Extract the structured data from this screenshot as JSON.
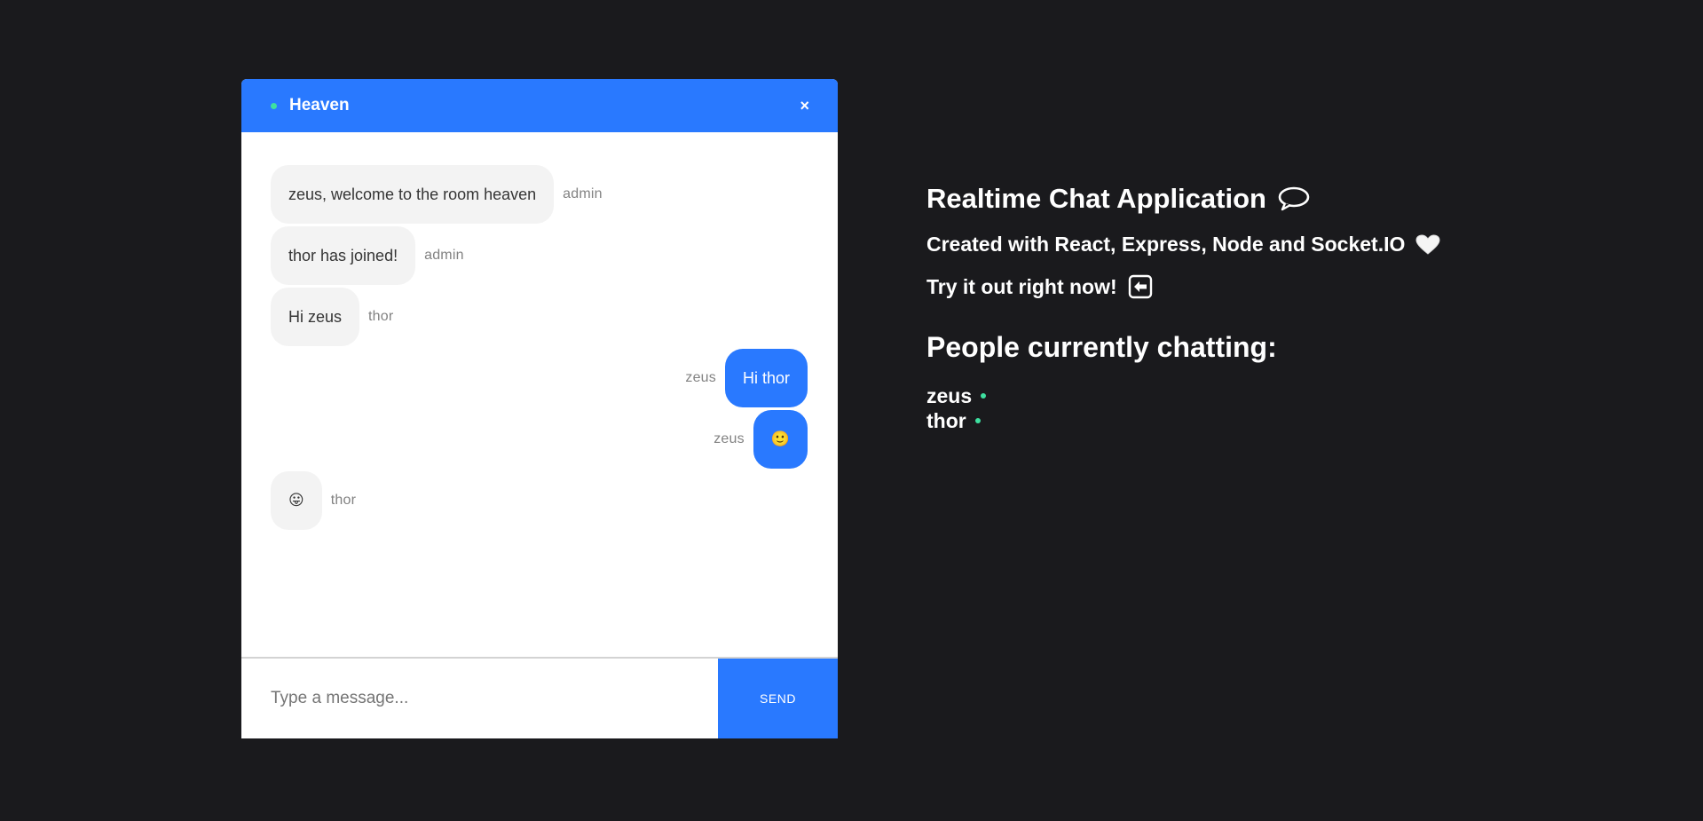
{
  "chat": {
    "room_name": "Heaven",
    "close_icon": "×",
    "messages": [
      {
        "text": "zeus, welcome to the room heaven",
        "sender": "admin",
        "side": "left"
      },
      {
        "text": "thor has joined!",
        "sender": "admin",
        "side": "left"
      },
      {
        "text": "Hi zeus",
        "sender": "thor",
        "side": "left"
      },
      {
        "text": "Hi thor",
        "sender": "zeus",
        "side": "right"
      },
      {
        "text": "🙂",
        "sender": "zeus",
        "side": "right"
      },
      {
        "text": "😛",
        "sender": "thor",
        "side": "left"
      }
    ],
    "input_placeholder": "Type a message...",
    "input_value": "",
    "send_label": "SEND"
  },
  "info": {
    "title": "Realtime Chat Application",
    "title_icon": "speech-balloon-icon",
    "subtitle": "Created with React, Express, Node and Socket.IO",
    "subtitle_icon": "white-heart-icon",
    "try_text": "Try it out right now!",
    "try_icon": "left-arrow-box-icon",
    "people_heading": "People currently chatting:",
    "people": [
      "zeus",
      "thor"
    ]
  },
  "colors": {
    "background": "#1a1a1d",
    "accent": "#2979ff",
    "online": "#3ee0a0",
    "bubble_light": "#f3f3f3"
  }
}
